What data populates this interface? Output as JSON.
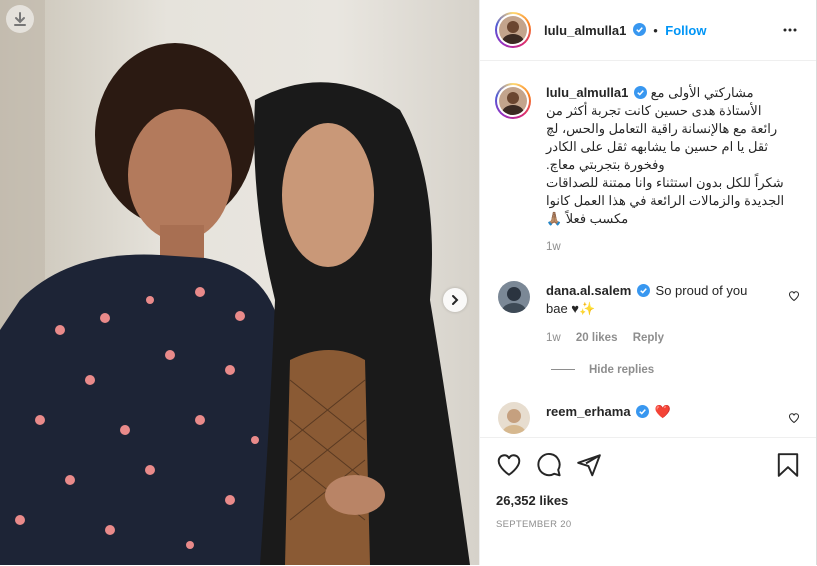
{
  "post": {
    "username": "lulu_almulla1",
    "follow_label": "Follow",
    "separator": "•",
    "caption_lines": [
      "مشاركتي الأولى مع",
      "الأستاذة هدى حسين كانت تجربة أكثر من",
      "رائعة مع هالإنسانة راقية التعامل والحس، لچ",
      "ثقل يا ام حسين ما يشابهه ثقل على الكادر",
      ".وفخورة بتجربتي معاچ",
      "شكراً للكل بدون استثناء وانا ممتنة للصداقات",
      "الجديدة والزمالات الرائعة في هذا العمل كانوا",
      "مكسب فعلاً 🙏🏽"
    ],
    "caption_time": "1w",
    "likes": "26,352 likes",
    "date": "SEPTEMBER 20"
  },
  "comments": [
    {
      "username": "dana.al.salem",
      "text_line1": "So proud of you",
      "text_line2": "bae ♥✨",
      "time": "1w",
      "likes": "20 likes",
      "reply": "Reply",
      "hide_replies": "Hide replies"
    },
    {
      "username": "reem_erhama",
      "text": "❤️"
    }
  ],
  "icons": {
    "download": "download-icon",
    "next": "chevron-right-icon",
    "verified": "verified-badge-icon",
    "more": "more-options-icon",
    "like": "heart-icon",
    "comment": "comment-icon",
    "share": "share-icon",
    "save": "bookmark-icon"
  },
  "colors": {
    "link_blue": "#0095f6",
    "verified_blue": "#3897f0",
    "red_heart": "#ed4956",
    "muted": "#8e8e8e",
    "text": "#262626"
  }
}
